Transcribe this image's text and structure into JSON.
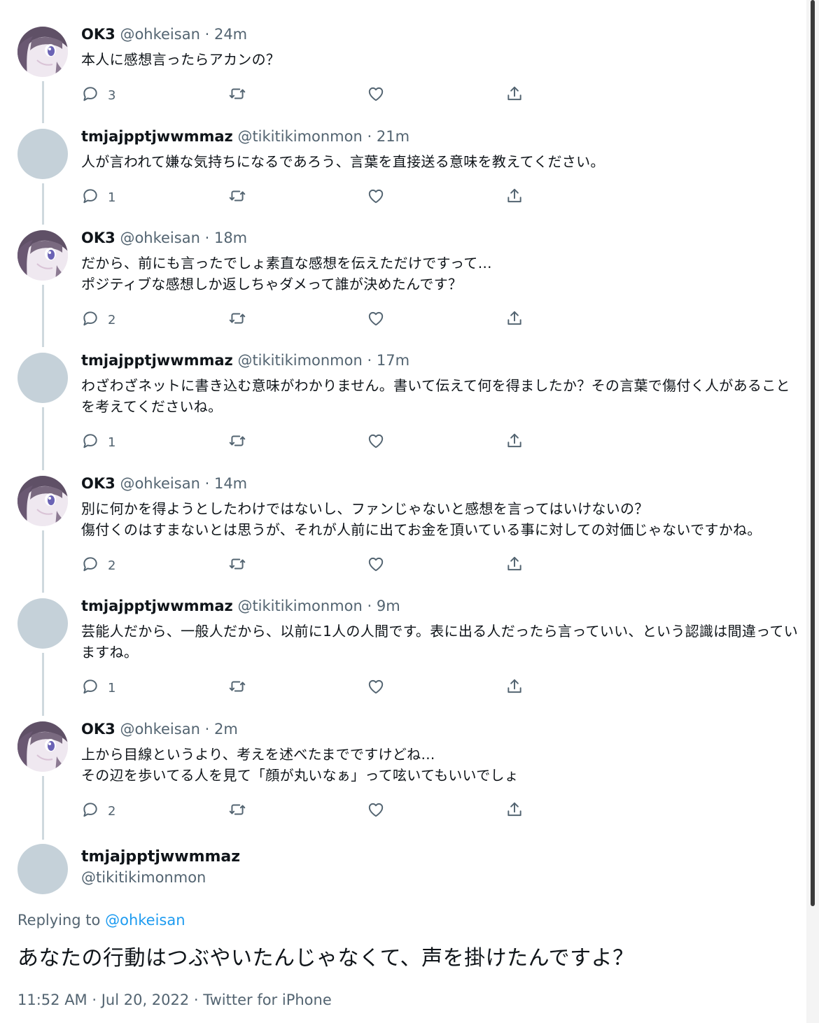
{
  "thread": {
    "tweets": [
      {
        "name": "OK3",
        "handle": "@ohkeisan",
        "dot": "·",
        "time": "24m",
        "text": "本人に感想言ったらアカンの？",
        "reply_count": "3",
        "avatar": "anime"
      },
      {
        "name": "tmjajpptjwwmmaz",
        "handle": "@tikitikimonmon",
        "dot": "·",
        "time": "21m",
        "text": "人が言われて嫌な気持ちになるであろう、言葉を直接送る意味を教えてください。",
        "reply_count": "1",
        "avatar": "gray"
      },
      {
        "name": "OK3",
        "handle": "@ohkeisan",
        "dot": "·",
        "time": "18m",
        "text": "だから、前にも言ったでしょ素直な感想を伝えただけですって…\nポジティブな感想しか返しちゃダメって誰が決めたんです？",
        "reply_count": "2",
        "avatar": "anime"
      },
      {
        "name": "tmjajpptjwwmmaz",
        "handle": "@tikitikimonmon",
        "dot": "·",
        "time": "17m",
        "text": "わざわざネットに書き込む意味がわかりません。書いて伝えて何を得ましたか？その言葉で傷付く人があることを考えてくださいね。",
        "reply_count": "1",
        "avatar": "gray"
      },
      {
        "name": "OK3",
        "handle": "@ohkeisan",
        "dot": "·",
        "time": "14m",
        "text": "別に何かを得ようとしたわけではないし、ファンじゃないと感想を言ってはいけないの？\n傷付くのはすまないとは思うが、それが人前に出てお金を頂いている事に対しての対価じゃないですかね。",
        "reply_count": "2",
        "avatar": "anime"
      },
      {
        "name": "tmjajpptjwwmmaz",
        "handle": "@tikitikimonmon",
        "dot": "·",
        "time": "9m",
        "text": "芸能人だから、一般人だから、以前に1人の人間です。表に出る人だったら言っていい、という認識は間違っていますね。",
        "reply_count": "1",
        "avatar": "gray"
      },
      {
        "name": "OK3",
        "handle": "@ohkeisan",
        "dot": "·",
        "time": "2m",
        "text": "上から目線というより、考えを述べたまでですけどね…\nその辺を歩いてる人を見て「顔が丸いなぁ」って呟いてもいいでしょ",
        "reply_count": "2",
        "avatar": "anime"
      }
    ]
  },
  "focus": {
    "name": "tmjajpptjwwmmaz",
    "handle": "@tikitikimonmon",
    "replying_label": "Replying to",
    "replying_to": "@ohkeisan",
    "text": "あなたの行動はつぶやいたんじゃなくて、声を掛けたんですよ？",
    "meta": "11:52 AM · Jul 20, 2022 · Twitter for iPhone"
  },
  "icons": [
    "reply-icon",
    "retweet-icon",
    "like-icon",
    "share-icon"
  ],
  "colors": {
    "text": "#0f1419",
    "muted": "#536471",
    "link": "#1d9bf0",
    "thread_line": "#cfd9de",
    "avatar_gray": "#c5d1d9"
  }
}
